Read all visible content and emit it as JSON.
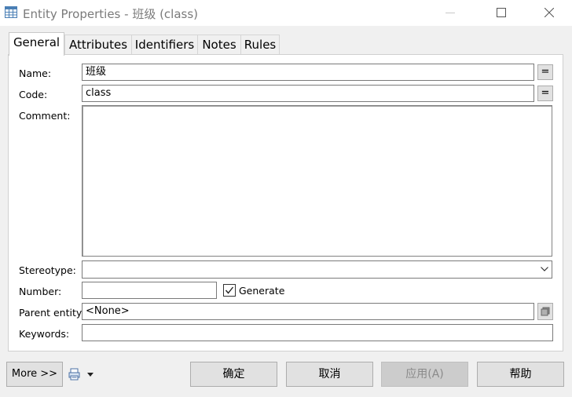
{
  "window": {
    "title": "Entity Properties - 班级 (class)",
    "icon": "table-icon"
  },
  "tabs": [
    {
      "label": "General",
      "active": true
    },
    {
      "label": "Attributes",
      "active": false
    },
    {
      "label": "Identifiers",
      "active": false
    },
    {
      "label": "Notes",
      "active": false
    },
    {
      "label": "Rules",
      "active": false
    }
  ],
  "form": {
    "name_label": "Name:",
    "name_value": "班级",
    "code_label": "Code:",
    "code_value": "class",
    "equals_label": "=",
    "comment_label": "Comment:",
    "comment_value": "",
    "stereotype_label": "Stereotype:",
    "stereotype_value": "",
    "number_label": "Number:",
    "number_value": "",
    "generate_label": "Generate",
    "generate_checked": true,
    "parent_entity_label": "Parent entity:",
    "parent_entity_value": "<None>",
    "keywords_label": "Keywords:",
    "keywords_value": ""
  },
  "buttons": {
    "more": "More >>",
    "ok": "确定",
    "cancel": "取消",
    "apply": "应用(A)",
    "help": "帮助"
  }
}
